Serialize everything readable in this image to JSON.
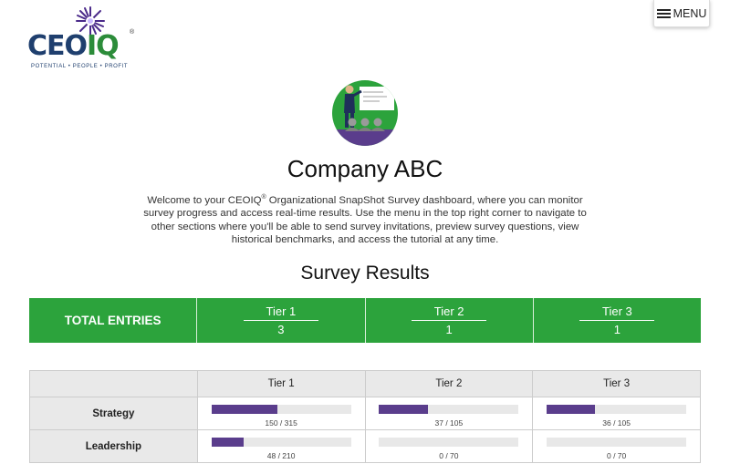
{
  "logo": {
    "wordmark_ceo": "CEO",
    "wordmark_iq": "IQ",
    "registered": "®",
    "tagline": "POTENTIAL • PEOPLE • PROFIT"
  },
  "menu": {
    "label": "MENU",
    "icon": "hamburger-icon"
  },
  "hero": {
    "icon": "presenter-illustration",
    "circle_color": "#2ca33c"
  },
  "page": {
    "title": "Company ABC",
    "welcome_pre": "Welcome to your CEOIQ",
    "welcome_reg": "®",
    "welcome_post": " Organizational SnapShot Survey dashboard, where you can monitor survey progress and access real-time results. Use the menu in the top right corner to navigate to other sections where you'll be able to send survey invitations, preview survey questions, view historical benchmarks, and access the tutorial at any time."
  },
  "results": {
    "title": "Survey Results",
    "totals_label": "TOTAL ENTRIES",
    "tiers": [
      {
        "label": "Tier 1",
        "count": "3"
      },
      {
        "label": "Tier 2",
        "count": "1"
      },
      {
        "label": "Tier 3",
        "count": "1"
      }
    ],
    "table_headers": [
      "Tier 1",
      "Tier 2",
      "Tier 3"
    ],
    "rows": [
      {
        "label": "Strategy",
        "cells": [
          {
            "text": "150 / 315",
            "fraction": 0.476
          },
          {
            "text": "37 / 105",
            "fraction": 0.352
          },
          {
            "text": "36 / 105",
            "fraction": 0.343
          }
        ]
      },
      {
        "label": "Leadership",
        "cells": [
          {
            "text": "48 / 210",
            "fraction": 0.229
          },
          {
            "text": "0 / 70",
            "fraction": 0
          },
          {
            "text": "0 / 70",
            "fraction": 0
          }
        ]
      }
    ]
  },
  "colors": {
    "brand_green": "#2ca33c",
    "brand_navy": "#1f3f6e",
    "progress_purple": "#5a3d8c"
  }
}
